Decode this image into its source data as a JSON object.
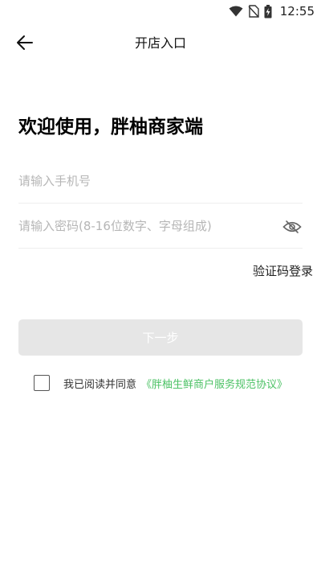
{
  "status_bar": {
    "time": "12:55"
  },
  "header": {
    "title": "开店入口"
  },
  "welcome": "欢迎使用，胖柚商家端",
  "form": {
    "phone_placeholder": "请输入手机号",
    "password_placeholder": "请输入密码(8-16位数字、字母组成)"
  },
  "sms_login_label": "验证码登录",
  "next_button_label": "下一步",
  "agreement": {
    "prefix": "我已阅读并同意",
    "link": "《胖柚生鲜商户服务规范协议》",
    "checked": false
  },
  "colors": {
    "link": "#4cc265",
    "button_disabled": "#e6e6e6"
  }
}
